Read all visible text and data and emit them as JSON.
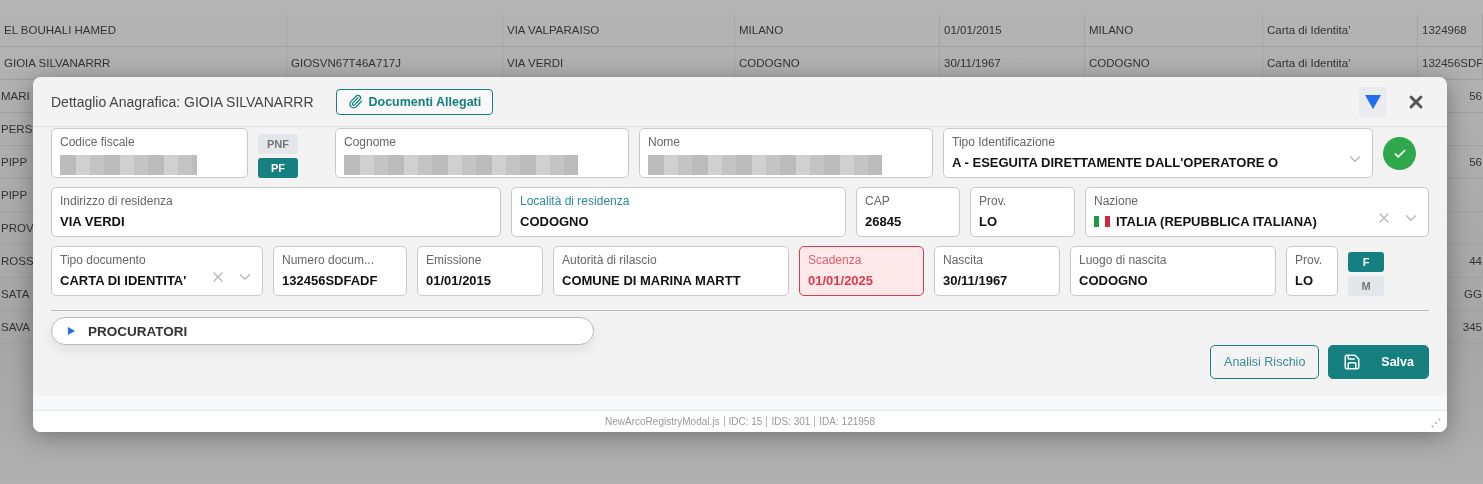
{
  "background_table": {
    "rows": [
      {
        "kind": "full",
        "cells": [
          "EL BOUHALI HAMED",
          null,
          "VIA VALPARAISO",
          "MILANO",
          "01/01/2015",
          "MILANO",
          "Carta di Identita'",
          "1324968"
        ]
      },
      {
        "kind": "full",
        "cells": [
          "GIOIA SILVANARRR",
          "GIOSVN67T46A717J",
          "VIA VERDI",
          "CODOGNO",
          "30/11/1967",
          "CODOGNO",
          "Carta di Identita'",
          "132456SDF"
        ]
      },
      {
        "kind": "partial",
        "start": "MARI",
        "end": "56"
      },
      {
        "kind": "partial",
        "start": "PERS"
      },
      {
        "kind": "partial",
        "start": "PIPP",
        "end": "56"
      },
      {
        "kind": "partial",
        "start": "PIPP"
      },
      {
        "kind": "partial",
        "start": "PROV"
      },
      {
        "kind": "partial",
        "start": "ROSS",
        "end": "44"
      },
      {
        "kind": "partial",
        "start": "SATA",
        "end": "GG"
      },
      {
        "kind": "partial",
        "start": "SAVA",
        "end": "345"
      }
    ]
  },
  "modal": {
    "title": "Dettaglio Anagrafica: GIOIA SILVANARRR",
    "attachments_button": "Documenti Allegati",
    "form_rows": [
      {
        "items": [
          {
            "kind": "blurred",
            "label": "Codice fiscale",
            "focused": false
          },
          {
            "kind": "toggle",
            "options": [
              {
                "label": "PNF",
                "selected": false
              },
              {
                "label": "PF",
                "selected": true
              }
            ]
          },
          {
            "kind": "blurred",
            "label": "Cognome",
            "focused": false
          },
          {
            "kind": "blurred",
            "label": "Nome",
            "focused": false
          },
          {
            "kind": "select",
            "label": "Tipo Identificazione",
            "value": "A - ESEGUITA DIRETTAMENTE DALL'OPERATORE O",
            "clearable": false,
            "focused": false
          },
          {
            "kind": "status",
            "valid": true
          }
        ]
      },
      {
        "items": [
          {
            "kind": "text",
            "label": "Indirizzo di residenza",
            "value": "VIA VERDI",
            "focused": false
          },
          {
            "kind": "text",
            "label": "Località di residenza",
            "value": "CODOGNO",
            "focused": true
          },
          {
            "kind": "text",
            "label": "CAP",
            "value": "26845",
            "focused": false
          },
          {
            "kind": "text",
            "label": "Prov.",
            "value": "LO",
            "focused": false
          },
          {
            "kind": "country",
            "label": "Nazione",
            "value": "ITALIA (REPUBBLICA ITALIANA)",
            "clearable": true,
            "focused": false
          }
        ]
      },
      {
        "items": [
          {
            "kind": "select",
            "label": "Tipo documento",
            "value": "CARTA DI IDENTITA'",
            "clearable": true,
            "focused": false
          },
          {
            "kind": "text",
            "label": "Numero docum...",
            "value": "132456SDFADF",
            "focused": false
          },
          {
            "kind": "text",
            "label": "Emissione",
            "value": "01/01/2015",
            "focused": false
          },
          {
            "kind": "text",
            "label": "Autorità di rilascio",
            "value": "COMUNE DI MARINA MARTT",
            "focused": false
          },
          {
            "kind": "text",
            "label": "Scadenza",
            "value": "01/01/2025",
            "focused": false,
            "error": true
          },
          {
            "kind": "text",
            "label": "Nascita",
            "value": "30/11/1967",
            "focused": false
          },
          {
            "kind": "text",
            "label": "Luogo di nascita",
            "value": "CODOGNO",
            "focused": false
          },
          {
            "kind": "text",
            "label": "Prov.",
            "value": "LO",
            "focused": false
          },
          {
            "kind": "toggle",
            "options": [
              {
                "label": "F",
                "selected": true
              },
              {
                "label": "M",
                "selected": false
              }
            ]
          }
        ]
      }
    ],
    "procuratori": {
      "label": "PROCURATORI",
      "expanded": false
    },
    "buttons": [
      {
        "kind": "outline",
        "label": "Analisi Rischio"
      },
      {
        "kind": "primary",
        "label": "Salva"
      }
    ],
    "footer": [
      "NewArcoRegistryModal.js",
      "IDC: 15",
      "IDS: 301",
      "IDA: 121958"
    ]
  }
}
